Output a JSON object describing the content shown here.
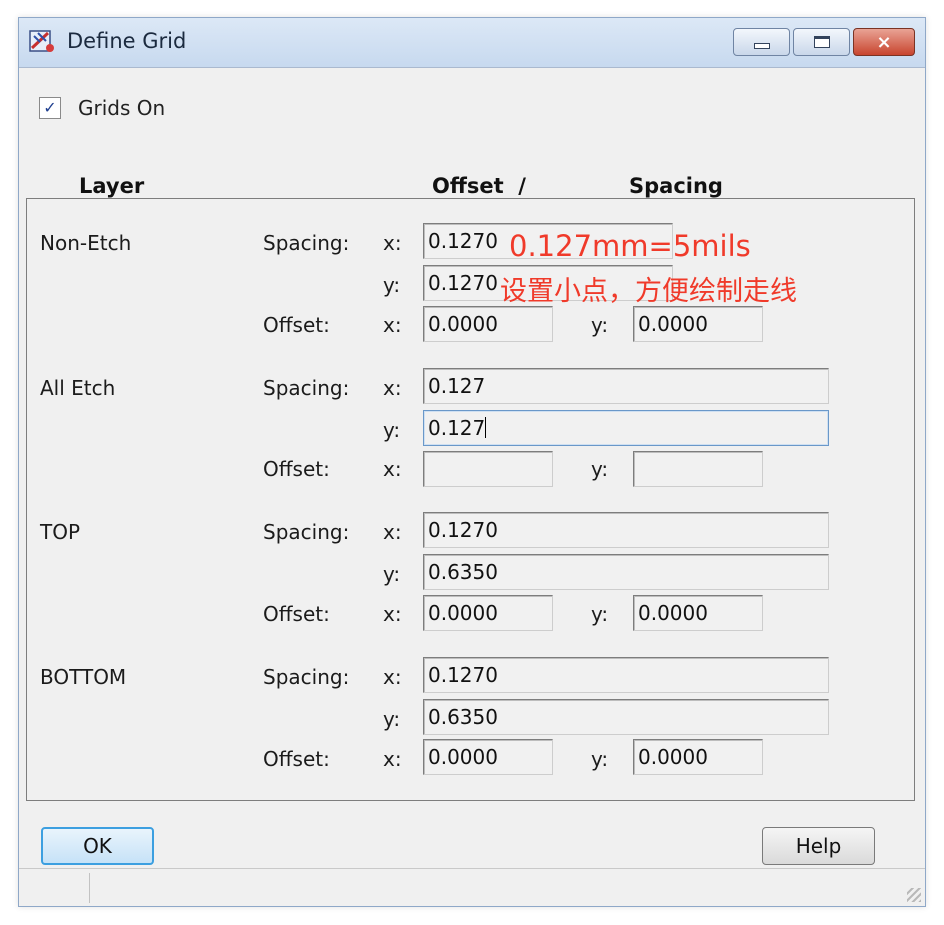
{
  "window": {
    "title": "Define Grid",
    "icon": "pcb-editor-app-icon",
    "controls": {
      "minimize": "minimize-icon",
      "maximize": "maximize-icon",
      "close": "×"
    }
  },
  "grids_on": {
    "label": "Grids On",
    "checked": true,
    "check_glyph": "✓"
  },
  "headers": {
    "layer": "Layer",
    "offset_spacing": "Offset  /",
    "spacing": "Spacing"
  },
  "layers": [
    {
      "name": "Non-Etch",
      "spacing_label": "Spacing:",
      "offset_label": "Offset:",
      "x_label": "x:",
      "y_label": "y:",
      "spacing_x": "0.1270",
      "spacing_y": "0.1270",
      "offset_x": "0.0000",
      "offset_y": "0.0000"
    },
    {
      "name": "All Etch",
      "spacing_label": "Spacing:",
      "offset_label": "Offset:",
      "x_label": "x:",
      "y_label": "y:",
      "spacing_x": "0.127",
      "spacing_y": "0.127",
      "offset_x": "",
      "offset_y": ""
    },
    {
      "name": "TOP",
      "spacing_label": "Spacing:",
      "offset_label": "Offset:",
      "x_label": "x:",
      "y_label": "y:",
      "spacing_x": "0.1270",
      "spacing_y": "0.6350",
      "offset_x": "0.0000",
      "offset_y": "0.0000"
    },
    {
      "name": "BOTTOM",
      "spacing_label": "Spacing:",
      "offset_label": "Offset:",
      "x_label": "x:",
      "y_label": "y:",
      "spacing_x": "0.1270",
      "spacing_y": "0.6350",
      "offset_x": "0.0000",
      "offset_y": "0.0000"
    }
  ],
  "annotation": {
    "line1": "0.127mm=5mils",
    "line2": "设置小点，方便绘制走线",
    "color": "#f03a2a"
  },
  "buttons": {
    "ok": "OK",
    "help": "Help"
  },
  "colors": {
    "title_bar": "#c7d9ef",
    "dialog_bg": "#f0f0f0",
    "default_button_border": "#3c9fe0"
  }
}
